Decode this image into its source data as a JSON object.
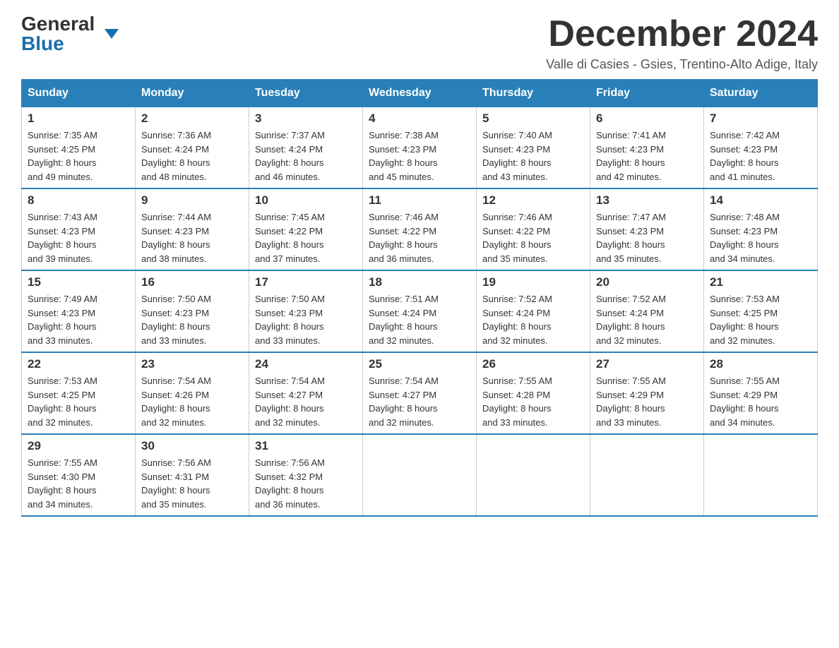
{
  "logo": {
    "general": "General",
    "blue": "Blue"
  },
  "header": {
    "month_year": "December 2024",
    "location": "Valle di Casies - Gsies, Trentino-Alto Adige, Italy"
  },
  "days_of_week": [
    "Sunday",
    "Monday",
    "Tuesday",
    "Wednesday",
    "Thursday",
    "Friday",
    "Saturday"
  ],
  "weeks": [
    [
      {
        "day": "1",
        "sunrise": "7:35 AM",
        "sunset": "4:25 PM",
        "daylight": "8 hours and 49 minutes."
      },
      {
        "day": "2",
        "sunrise": "7:36 AM",
        "sunset": "4:24 PM",
        "daylight": "8 hours and 48 minutes."
      },
      {
        "day": "3",
        "sunrise": "7:37 AM",
        "sunset": "4:24 PM",
        "daylight": "8 hours and 46 minutes."
      },
      {
        "day": "4",
        "sunrise": "7:38 AM",
        "sunset": "4:23 PM",
        "daylight": "8 hours and 45 minutes."
      },
      {
        "day": "5",
        "sunrise": "7:40 AM",
        "sunset": "4:23 PM",
        "daylight": "8 hours and 43 minutes."
      },
      {
        "day": "6",
        "sunrise": "7:41 AM",
        "sunset": "4:23 PM",
        "daylight": "8 hours and 42 minutes."
      },
      {
        "day": "7",
        "sunrise": "7:42 AM",
        "sunset": "4:23 PM",
        "daylight": "8 hours and 41 minutes."
      }
    ],
    [
      {
        "day": "8",
        "sunrise": "7:43 AM",
        "sunset": "4:23 PM",
        "daylight": "8 hours and 39 minutes."
      },
      {
        "day": "9",
        "sunrise": "7:44 AM",
        "sunset": "4:23 PM",
        "daylight": "8 hours and 38 minutes."
      },
      {
        "day": "10",
        "sunrise": "7:45 AM",
        "sunset": "4:22 PM",
        "daylight": "8 hours and 37 minutes."
      },
      {
        "day": "11",
        "sunrise": "7:46 AM",
        "sunset": "4:22 PM",
        "daylight": "8 hours and 36 minutes."
      },
      {
        "day": "12",
        "sunrise": "7:46 AM",
        "sunset": "4:22 PM",
        "daylight": "8 hours and 35 minutes."
      },
      {
        "day": "13",
        "sunrise": "7:47 AM",
        "sunset": "4:23 PM",
        "daylight": "8 hours and 35 minutes."
      },
      {
        "day": "14",
        "sunrise": "7:48 AM",
        "sunset": "4:23 PM",
        "daylight": "8 hours and 34 minutes."
      }
    ],
    [
      {
        "day": "15",
        "sunrise": "7:49 AM",
        "sunset": "4:23 PM",
        "daylight": "8 hours and 33 minutes."
      },
      {
        "day": "16",
        "sunrise": "7:50 AM",
        "sunset": "4:23 PM",
        "daylight": "8 hours and 33 minutes."
      },
      {
        "day": "17",
        "sunrise": "7:50 AM",
        "sunset": "4:23 PM",
        "daylight": "8 hours and 33 minutes."
      },
      {
        "day": "18",
        "sunrise": "7:51 AM",
        "sunset": "4:24 PM",
        "daylight": "8 hours and 32 minutes."
      },
      {
        "day": "19",
        "sunrise": "7:52 AM",
        "sunset": "4:24 PM",
        "daylight": "8 hours and 32 minutes."
      },
      {
        "day": "20",
        "sunrise": "7:52 AM",
        "sunset": "4:24 PM",
        "daylight": "8 hours and 32 minutes."
      },
      {
        "day": "21",
        "sunrise": "7:53 AM",
        "sunset": "4:25 PM",
        "daylight": "8 hours and 32 minutes."
      }
    ],
    [
      {
        "day": "22",
        "sunrise": "7:53 AM",
        "sunset": "4:25 PM",
        "daylight": "8 hours and 32 minutes."
      },
      {
        "day": "23",
        "sunrise": "7:54 AM",
        "sunset": "4:26 PM",
        "daylight": "8 hours and 32 minutes."
      },
      {
        "day": "24",
        "sunrise": "7:54 AM",
        "sunset": "4:27 PM",
        "daylight": "8 hours and 32 minutes."
      },
      {
        "day": "25",
        "sunrise": "7:54 AM",
        "sunset": "4:27 PM",
        "daylight": "8 hours and 32 minutes."
      },
      {
        "day": "26",
        "sunrise": "7:55 AM",
        "sunset": "4:28 PM",
        "daylight": "8 hours and 33 minutes."
      },
      {
        "day": "27",
        "sunrise": "7:55 AM",
        "sunset": "4:29 PM",
        "daylight": "8 hours and 33 minutes."
      },
      {
        "day": "28",
        "sunrise": "7:55 AM",
        "sunset": "4:29 PM",
        "daylight": "8 hours and 34 minutes."
      }
    ],
    [
      {
        "day": "29",
        "sunrise": "7:55 AM",
        "sunset": "4:30 PM",
        "daylight": "8 hours and 34 minutes."
      },
      {
        "day": "30",
        "sunrise": "7:56 AM",
        "sunset": "4:31 PM",
        "daylight": "8 hours and 35 minutes."
      },
      {
        "day": "31",
        "sunrise": "7:56 AM",
        "sunset": "4:32 PM",
        "daylight": "8 hours and 36 minutes."
      },
      null,
      null,
      null,
      null
    ]
  ],
  "labels": {
    "sunrise": "Sunrise:",
    "sunset": "Sunset:",
    "daylight": "Daylight:"
  }
}
